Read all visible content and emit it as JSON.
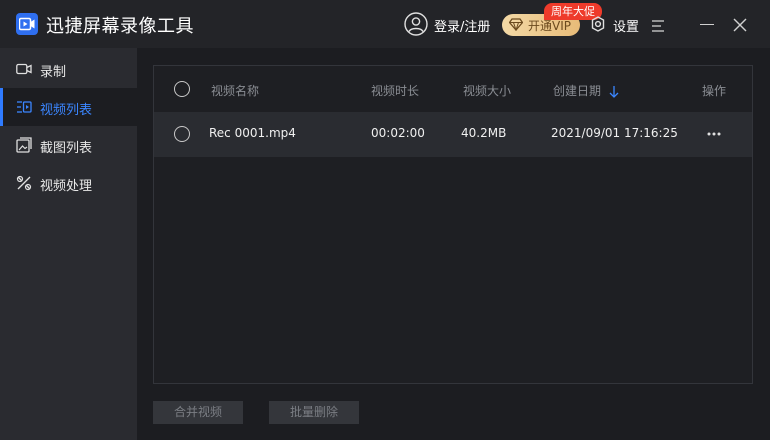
{
  "app": {
    "title": "迅捷屏幕录像工具"
  },
  "header": {
    "login_label": "登录/注册",
    "vip_label": "开通VIP",
    "promo_badge": "周年大促",
    "settings_label": "设置"
  },
  "sidebar": {
    "items": [
      {
        "label": "录制",
        "icon": "camera-icon",
        "active": false
      },
      {
        "label": "视频列表",
        "icon": "list-icon",
        "active": true
      },
      {
        "label": "截图列表",
        "icon": "image-icon",
        "active": false
      },
      {
        "label": "视频处理",
        "icon": "tools-icon",
        "active": false
      }
    ]
  },
  "table": {
    "columns": [
      "视频名称",
      "视频时长",
      "视频大小",
      "创建日期",
      "操作"
    ],
    "sort_column": "创建日期",
    "rows": [
      {
        "name": "Rec 0001.mp4",
        "duration": "00:02:00",
        "size": "40.2MB",
        "date": "2021/09/01 17:16:25"
      }
    ]
  },
  "footer": {
    "merge_label": "合并视频",
    "batch_delete_label": "批量删除"
  },
  "colors": {
    "accent": "#2f7bff",
    "vip_gold": "#e7bb78",
    "promo_red": "#ee3b2b"
  }
}
